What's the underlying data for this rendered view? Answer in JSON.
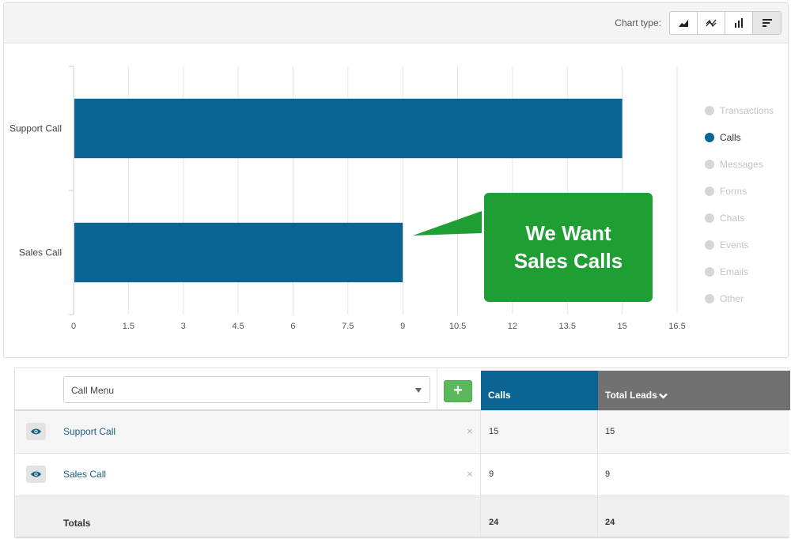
{
  "chart_toolbar": {
    "label": "Chart type:",
    "types": [
      {
        "name": "area",
        "icon": "area-chart-icon",
        "active": false
      },
      {
        "name": "line",
        "icon": "line-chart-icon",
        "active": false
      },
      {
        "name": "column",
        "icon": "column-chart-icon",
        "active": false
      },
      {
        "name": "bar",
        "icon": "bar-chart-icon",
        "active": true
      }
    ]
  },
  "chart_data": {
    "type": "bar",
    "orientation": "horizontal",
    "categories": [
      "Support Call",
      "Sales Call"
    ],
    "series": [
      {
        "name": "Calls",
        "values": [
          15,
          9
        ],
        "color": "#0b6492"
      }
    ],
    "xlim": [
      0,
      16.5
    ],
    "xticks": [
      "0",
      "1.5",
      "3",
      "4.5",
      "6",
      "7.5",
      "9",
      "10.5",
      "12",
      "13.5",
      "15",
      "16.5"
    ],
    "grid": true,
    "legend_position": "right"
  },
  "legend": [
    {
      "label": "Transactions",
      "active": false
    },
    {
      "label": "Calls",
      "active": true
    },
    {
      "label": "Messages",
      "active": false
    },
    {
      "label": "Forms",
      "active": false
    },
    {
      "label": "Chats",
      "active": false
    },
    {
      "label": "Events",
      "active": false
    },
    {
      "label": "Emails",
      "active": false
    },
    {
      "label": "Other",
      "active": false
    }
  ],
  "callout": {
    "line1": "We Want",
    "line2": "Sales Calls",
    "color": "#1f9e33"
  },
  "table": {
    "call_menu_value": "Call Menu",
    "add_label": "+",
    "columns": {
      "calls": "Calls",
      "total_leads": "Total Leads"
    },
    "rows": [
      {
        "name": "Support Call",
        "calls": "15",
        "total_leads": "15"
      },
      {
        "name": "Sales Call",
        "calls": "9",
        "total_leads": "9"
      }
    ],
    "totals": {
      "label": "Totals",
      "calls": "24",
      "total_leads": "24"
    },
    "remove_label": "×"
  },
  "colors": {
    "primary": "#0b6492",
    "success": "#5cb85c",
    "header_gray": "#717171"
  }
}
